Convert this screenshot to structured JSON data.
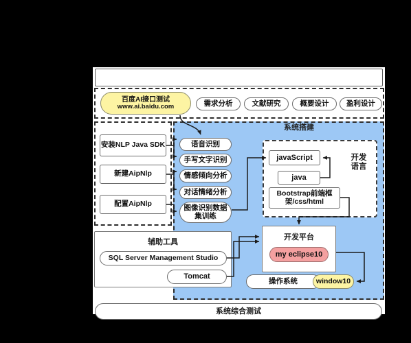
{
  "diagram": {
    "type": "flowchart",
    "background": "#000000",
    "canvas": "#ffffff",
    "panel_color": "#9dc8f5",
    "accent_yellow": "#fdf4a3",
    "accent_pink": "#f4a0a0"
  },
  "top_bar": {
    "label": ""
  },
  "phase_row": {
    "baidu": {
      "line1": "百度AI接口测试",
      "line2": "www.ai.baidu.com"
    },
    "steps": [
      {
        "label": "需求分析"
      },
      {
        "label": "文献研究"
      },
      {
        "label": "概要设计"
      },
      {
        "label": "盈利设计"
      }
    ]
  },
  "sdk_group": {
    "items": [
      {
        "label": "安装NLP Java SDK"
      },
      {
        "label": "新建AipNlp"
      },
      {
        "label": "配置AipNlp"
      }
    ]
  },
  "capabilities": {
    "items": [
      {
        "label": "语音识别"
      },
      {
        "label": "手写文字识别"
      },
      {
        "label": "情感倾向分析"
      },
      {
        "label": "对话情绪分析"
      },
      {
        "label": "图像识别数据集训练"
      }
    ]
  },
  "system_build": {
    "title": "系统搭建",
    "dev_language": {
      "caption": "开发\n语言",
      "caption_line1": "开发",
      "caption_line2": "语言",
      "items": [
        {
          "label": "javaScript"
        },
        {
          "label": "java"
        },
        {
          "label": "Bootstrap前端框架/css/html"
        }
      ]
    },
    "dev_platform": {
      "title": "开发平台",
      "item": {
        "label": "my eclipse10"
      }
    },
    "operating_system": {
      "label": "操作系统",
      "value": "window10"
    }
  },
  "tools_group": {
    "title": "辅助工具",
    "items": [
      {
        "label": "SQL Server Management Studio"
      },
      {
        "label": "Tomcat"
      }
    ]
  },
  "bottom_bar": {
    "label": "系统综合测试"
  }
}
